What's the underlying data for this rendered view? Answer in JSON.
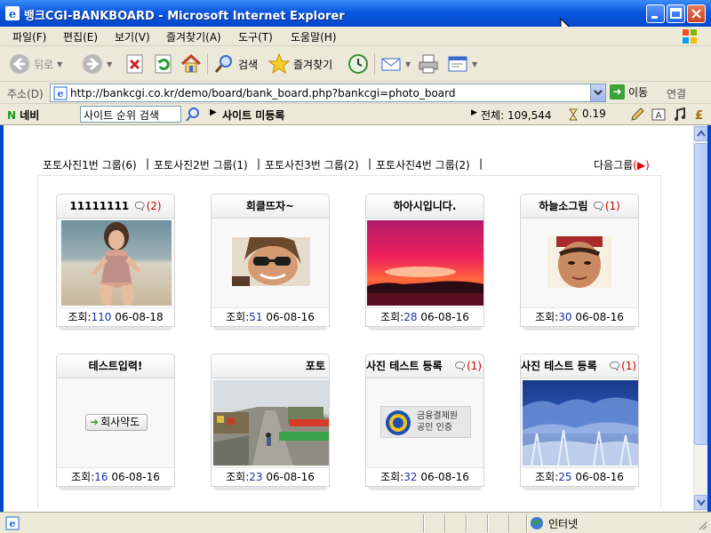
{
  "window": {
    "title": "뱅크CGI-BANKBOARD - Microsoft Internet Explorer"
  },
  "menu": [
    "파일(F)",
    "편집(E)",
    "보기(V)",
    "즐겨찾기(A)",
    "도구(T)",
    "도움말(H)"
  ],
  "toolbar": {
    "back": "뒤로",
    "search": "검색",
    "favorites": "즐겨찾기"
  },
  "address": {
    "label": "주소(D)",
    "url": "http://bankcgi.co.kr/demo/board/bank_board.php?bankcgi=photo_board",
    "go": "이동",
    "links": "연결"
  },
  "naver": {
    "logo_n": "N",
    "logo_text": "네비",
    "search_value": "사이트 순위 검색",
    "register": "사이트 미등록",
    "total": "전체: 109,544",
    "time": "0.19"
  },
  "groups": {
    "links": [
      "포토사진1번 그룹(6)",
      "포토사진2번 그룹(1)",
      "포토사진3번 그룹(2)",
      "포토사진4번 그룹(2)"
    ],
    "separator": "|",
    "next": "다음그룹",
    "next_arrow": "(▶)"
  },
  "cards": [
    {
      "title": "11111111",
      "comments": "(2)",
      "views_label": "조회:",
      "views": "110",
      "date": "06-08-18",
      "image": "beach-woman-photo"
    },
    {
      "title": "회클뜨자~",
      "comments": "",
      "views_label": "조회:",
      "views": "51",
      "date": "06-08-16",
      "image": "man-sunglasses-photo"
    },
    {
      "title": "하아시입니다.",
      "comments": "",
      "views_label": "조회:",
      "views": "28",
      "date": "06-08-16",
      "image": "sunset-photo"
    },
    {
      "title": "하늘소그림",
      "comments": "(1)",
      "views_label": "조회:",
      "views": "30",
      "date": "06-08-16",
      "image": "man-headband-photo"
    },
    {
      "title": "테스트입력!",
      "comments": "",
      "views_label": "조회:",
      "views": "16",
      "date": "06-08-16",
      "image": "company-map-button",
      "badge": "회사약도"
    },
    {
      "title": "포토",
      "comments": "",
      "views_label": "조회:",
      "views": "23",
      "date": "06-08-16",
      "image": "street-photo"
    },
    {
      "title": "사진 테스트 등록",
      "comments": "(1)",
      "views_label": "조회:",
      "views": "32",
      "date": "06-08-16",
      "image": "payment-logo",
      "badge_line1": "금융결제원",
      "badge_line2": "공인 인증"
    },
    {
      "title": "사진 테스트 등록",
      "comments": "(1)",
      "views_label": "조회:",
      "views": "25",
      "date": "06-08-16",
      "image": "snow-forest-photo"
    }
  ],
  "status": {
    "zone": "인터넷"
  },
  "colors": {
    "titlebar": "#0a58df",
    "chrome": "#ece9d8",
    "comment_count": "#d00000",
    "views": "#1a2fa8",
    "next_arrow": "#e00000"
  }
}
